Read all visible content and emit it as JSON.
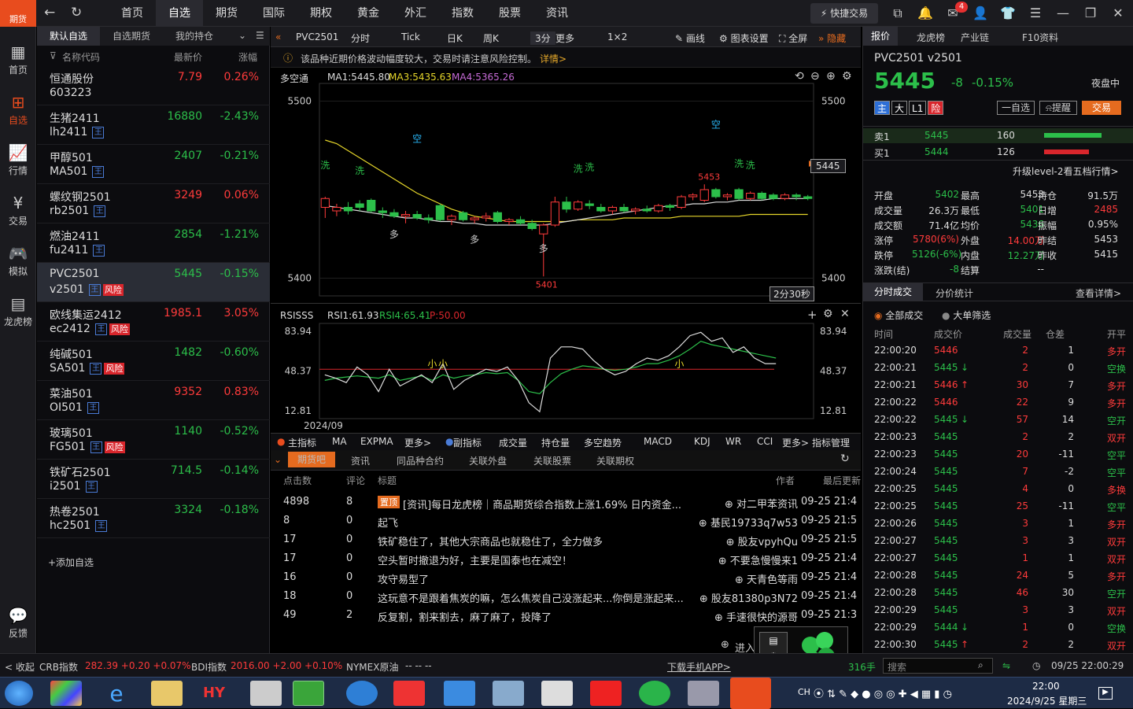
{
  "app": {
    "logo_label": "期货"
  },
  "nav": {
    "items": [
      "首页",
      "自选",
      "期货",
      "国际",
      "期权",
      "黄金",
      "外汇",
      "指数",
      "股票",
      "资讯"
    ],
    "active_index": 1,
    "quick_trade": "快捷交易",
    "mail_badge": "4"
  },
  "leftnav": [
    {
      "label": "首页",
      "icon": "grid-icon"
    },
    {
      "label": "自选",
      "icon": "plus-box-icon"
    },
    {
      "label": "行情",
      "icon": "chart-icon"
    },
    {
      "label": "交易",
      "icon": "yuan-icon"
    },
    {
      "label": "模拟",
      "icon": "gamepad-icon"
    },
    {
      "label": "龙虎榜",
      "icon": "database-icon"
    },
    {
      "label": "反馈",
      "icon": "feedback-icon"
    }
  ],
  "watchlist": {
    "tabs": [
      "默认自选",
      "自选期货",
      "我的持仓"
    ],
    "header": {
      "name": "名称代码",
      "price": "最新价",
      "change": "涨幅"
    },
    "rows": [
      {
        "name": "恒通股份",
        "code": "603223",
        "price": "7.79",
        "change": "0.26%",
        "dir": "up",
        "tag": false,
        "risk": false
      },
      {
        "name": "生猪2411",
        "code": "lh2411",
        "price": "16880",
        "change": "-2.43%",
        "dir": "down",
        "tag": true,
        "risk": false
      },
      {
        "name": "甲醇501",
        "code": "MA501",
        "price": "2407",
        "change": "-0.21%",
        "dir": "down",
        "tag": true,
        "risk": false
      },
      {
        "name": "螺纹钢2501",
        "code": "rb2501",
        "price": "3249",
        "change": "0.06%",
        "dir": "up",
        "tag": true,
        "risk": false
      },
      {
        "name": "燃油2411",
        "code": "fu2411",
        "price": "2854",
        "change": "-1.21%",
        "dir": "down",
        "tag": true,
        "risk": false
      },
      {
        "name": "PVC2501",
        "code": "v2501",
        "price": "5445",
        "change": "-0.15%",
        "dir": "down",
        "tag": true,
        "risk": true
      },
      {
        "name": "欧线集运2412",
        "code": "ec2412",
        "price": "1985.1",
        "change": "3.05%",
        "dir": "up",
        "tag": true,
        "risk": true
      },
      {
        "name": "纯碱501",
        "code": "SA501",
        "price": "1482",
        "change": "-0.60%",
        "dir": "down",
        "tag": true,
        "risk": true
      },
      {
        "name": "菜油501",
        "code": "OI501",
        "price": "9352",
        "change": "0.83%",
        "dir": "up",
        "tag": true,
        "risk": false
      },
      {
        "name": "玻璃501",
        "code": "FG501",
        "price": "1140",
        "change": "-0.52%",
        "dir": "down",
        "tag": true,
        "risk": true
      },
      {
        "name": "铁矿石2501",
        "code": "i2501",
        "price": "714.5",
        "change": "-0.14%",
        "dir": "down",
        "tag": true,
        "risk": false
      },
      {
        "name": "热卷2501",
        "code": "hc2501",
        "price": "3324",
        "change": "-0.18%",
        "dir": "down",
        "tag": true,
        "risk": false
      }
    ],
    "selected_index": 5,
    "tag_char": "王",
    "risk_label": "风险",
    "add": "+添加自选"
  },
  "chartbar": {
    "symbol": "PVC2501",
    "items": [
      "分时",
      "Tick",
      "日K",
      "周K",
      "3分",
      "更多",
      "1×2"
    ],
    "tools": [
      "画线",
      "图表设置",
      "全屏",
      "隐藏"
    ]
  },
  "notice": {
    "text": "该品种近期价格波动幅度较大，交易时请注意风险控制。",
    "link": "详情>"
  },
  "main_chart": {
    "legend": {
      "label": "多空通",
      "ma1": "MA1:5445.80",
      "ma3": "MA3:5435.63",
      "ma4": "MA4:5365.26"
    },
    "ylabels": [
      "5500",
      "5400"
    ],
    "price_tag": "5445",
    "high_label": "5453",
    "low_label": "5401",
    "countdown": "2分30秒",
    "signals": [
      "洗",
      "洗",
      "空",
      "多",
      "多",
      "多",
      "洗",
      "洗",
      "洗",
      "洗",
      "空"
    ]
  },
  "chart_data": {
    "type": "candlestick",
    "ylim": [
      5390,
      5510
    ],
    "candles": [
      {
        "o": 5440,
        "h": 5446,
        "l": 5434,
        "c": 5445
      },
      {
        "o": 5438,
        "h": 5442,
        "l": 5435,
        "c": 5440
      },
      {
        "o": 5440,
        "h": 5443,
        "l": 5436,
        "c": 5438
      },
      {
        "o": 5442,
        "h": 5444,
        "l": 5438,
        "c": 5440
      },
      {
        "o": 5444,
        "h": 5445,
        "l": 5437,
        "c": 5438
      },
      {
        "o": 5438,
        "h": 5440,
        "l": 5434,
        "c": 5437
      },
      {
        "o": 5437,
        "h": 5439,
        "l": 5434,
        "c": 5435
      },
      {
        "o": 5435,
        "h": 5438,
        "l": 5431,
        "c": 5436
      },
      {
        "o": 5436,
        "h": 5438,
        "l": 5433,
        "c": 5434
      },
      {
        "o": 5434,
        "h": 5436,
        "l": 5431,
        "c": 5433
      },
      {
        "o": 5441,
        "h": 5442,
        "l": 5432,
        "c": 5433
      },
      {
        "o": 5433,
        "h": 5436,
        "l": 5430,
        "c": 5435
      },
      {
        "o": 5437,
        "h": 5438,
        "l": 5432,
        "c": 5433
      },
      {
        "o": 5433,
        "h": 5435,
        "l": 5431,
        "c": 5434
      },
      {
        "o": 5434,
        "h": 5437,
        "l": 5432,
        "c": 5435
      },
      {
        "o": 5437,
        "h": 5438,
        "l": 5431,
        "c": 5432
      },
      {
        "o": 5432,
        "h": 5434,
        "l": 5430,
        "c": 5433
      },
      {
        "o": 5433,
        "h": 5435,
        "l": 5430,
        "c": 5431
      },
      {
        "o": 5431,
        "h": 5433,
        "l": 5427,
        "c": 5428
      },
      {
        "o": 5425,
        "h": 5431,
        "l": 5401,
        "c": 5430
      },
      {
        "o": 5430,
        "h": 5446,
        "l": 5429,
        "c": 5443
      },
      {
        "o": 5443,
        "h": 5446,
        "l": 5437,
        "c": 5439
      },
      {
        "o": 5439,
        "h": 5444,
        "l": 5438,
        "c": 5443
      },
      {
        "o": 5442,
        "h": 5444,
        "l": 5439,
        "c": 5441
      },
      {
        "o": 5440,
        "h": 5442,
        "l": 5437,
        "c": 5438
      },
      {
        "o": 5438,
        "h": 5441,
        "l": 5436,
        "c": 5440
      },
      {
        "o": 5440,
        "h": 5442,
        "l": 5437,
        "c": 5438
      },
      {
        "o": 5438,
        "h": 5440,
        "l": 5436,
        "c": 5439
      },
      {
        "o": 5439,
        "h": 5441,
        "l": 5437,
        "c": 5438
      },
      {
        "o": 5438,
        "h": 5442,
        "l": 5437,
        "c": 5441
      },
      {
        "o": 5441,
        "h": 5442,
        "l": 5438,
        "c": 5440
      },
      {
        "o": 5440,
        "h": 5447,
        "l": 5439,
        "c": 5446
      },
      {
        "o": 5446,
        "h": 5448,
        "l": 5444,
        "c": 5447
      },
      {
        "o": 5444,
        "h": 5453,
        "l": 5443,
        "c": 5450
      },
      {
        "o": 5450,
        "h": 5451,
        "l": 5445,
        "c": 5446
      },
      {
        "o": 5446,
        "h": 5448,
        "l": 5444,
        "c": 5447
      },
      {
        "o": 5450,
        "h": 5451,
        "l": 5444,
        "c": 5445
      },
      {
        "o": 5445,
        "h": 5449,
        "l": 5444,
        "c": 5448
      },
      {
        "o": 5448,
        "h": 5449,
        "l": 5444,
        "c": 5445
      },
      {
        "o": 5447,
        "h": 5448,
        "l": 5444,
        "c": 5445
      },
      {
        "o": 5445,
        "h": 5448,
        "l": 5444,
        "c": 5447
      },
      {
        "o": 5447,
        "h": 5448,
        "l": 5444,
        "c": 5446
      },
      {
        "o": 5446,
        "h": 5447,
        "l": 5444,
        "c": 5445
      }
    ],
    "ma1": [
      5441,
      5440,
      5439,
      5438,
      5437,
      5436,
      5435,
      5434,
      5434,
      5433,
      5432,
      5432,
      5431,
      5431,
      5430,
      5430,
      5430,
      5430,
      5430,
      5430,
      5431,
      5432,
      5433,
      5434,
      5435,
      5436,
      5437,
      5438,
      5439,
      5440,
      5441,
      5441,
      5442,
      5442,
      5443,
      5443,
      5444,
      5444,
      5444,
      5445,
      5445,
      5445,
      5445
    ],
    "ma3": [
      5478,
      5476,
      5472,
      5468,
      5464,
      5460,
      5456,
      5452,
      5448,
      5445,
      5442,
      5439,
      5437,
      5435,
      5434,
      5433,
      5432,
      5432,
      5432,
      5432,
      5432,
      5432,
      5433,
      5433,
      5433,
      5433,
      5434,
      5434,
      5434,
      5434,
      5434,
      5435,
      5435,
      5435,
      5435,
      5435,
      5435,
      5436,
      5436,
      5436,
      5436,
      5436,
      5436
    ],
    "ma4": [
      5332,
      5333,
      5334,
      5335,
      5336,
      5337,
      5338,
      5339,
      5340,
      5341,
      5342,
      5342,
      5343,
      5344,
      5345,
      5346,
      5347,
      5348,
      5349,
      5350,
      5350,
      5351,
      5352,
      5353,
      5354,
      5355,
      5356,
      5356,
      5357,
      5358,
      5359,
      5360,
      5361,
      5362,
      5362,
      5363,
      5364,
      5364,
      5365,
      5366,
      5366,
      5367,
      5368
    ]
  },
  "rsi_chart": {
    "legend": {
      "label": "RSISSS",
      "rsi1": "RSI1:61.93",
      "rsi4": "RSI4:65.41",
      "p": "P:50.00"
    },
    "ylabels": [
      "83.94",
      "48.37",
      "12.81"
    ],
    "date": "2024/09",
    "ylim": [
      12.81,
      83.94
    ],
    "rsi1": [
      45,
      42,
      38,
      52,
      45,
      30,
      50,
      35,
      40,
      45,
      38,
      55,
      32,
      40,
      45,
      50,
      48,
      52,
      40,
      20,
      12,
      60,
      70,
      70,
      68,
      58,
      50,
      45,
      48,
      55,
      60,
      58,
      62,
      70,
      80,
      83,
      75,
      78,
      65,
      70,
      60,
      55,
      55
    ],
    "rsi4": [
      40,
      42,
      43,
      44,
      43,
      42,
      45,
      40,
      42,
      44,
      40,
      45,
      42,
      44,
      45,
      47,
      46,
      47,
      40,
      30,
      28,
      38,
      46,
      50,
      53,
      52,
      50,
      49,
      50,
      52,
      55,
      55,
      58,
      62,
      68,
      75,
      72,
      70,
      68,
      66,
      64,
      62,
      60
    ],
    "p": 50,
    "marks": [
      "小",
      "小",
      "小"
    ]
  },
  "indbar": {
    "main": "主指标",
    "items1": [
      "MA",
      "EXPMA",
      "更多>"
    ],
    "sub": "副指标",
    "items2": [
      "成交量",
      "持仓量",
      "多空趋势",
      "MACD",
      "KDJ",
      "WR",
      "CCI",
      "更多>"
    ],
    "manage": "指标管理"
  },
  "news": {
    "tabs": [
      "期货吧",
      "资讯",
      "同品种合约",
      "关联外盘",
      "关联股票",
      "关联期权"
    ],
    "header": {
      "clicks": "点击数",
      "comments": "评论",
      "title": "标题",
      "author": "作者",
      "updated": "最后更新"
    },
    "pinned": "置顶",
    "rows": [
      {
        "clicks": "4898",
        "comments": "8",
        "title": "[资讯]每日龙虎榜｜商品期货综合指数上涨1.69% 日内资金...",
        "author": "对二甲苯资讯",
        "time": "09-25 21:4",
        "pinned": true
      },
      {
        "clicks": "8",
        "comments": "0",
        "title": "起飞",
        "author": "基民19733q7w53",
        "time": "09-25 21:5",
        "pinned": false
      },
      {
        "clicks": "17",
        "comments": "0",
        "title": "铁矿稳住了，其他大宗商品也就稳住了，全力做多",
        "author": "股友vpyhQu",
        "time": "09-25 21:5",
        "pinned": false
      },
      {
        "clicks": "17",
        "comments": "0",
        "title": "空头暂时撤退为好，主要是国泰也在减空！",
        "author": "不要急慢慢来1",
        "time": "09-25 21:4",
        "pinned": false
      },
      {
        "clicks": "16",
        "comments": "0",
        "title": "攻守易型了",
        "author": "天青色等雨",
        "time": "09-25 21:4",
        "pinned": false
      },
      {
        "clicks": "18",
        "comments": "0",
        "title": "这玩意不是跟着焦炭的嘛，怎么焦炭自己没涨起来...你倒是涨起来...",
        "author": "股友81380p3N72",
        "time": "09-25 21:4",
        "pinned": false
      },
      {
        "clicks": "49",
        "comments": "2",
        "title": "反复割，割来割去，麻了麻了，投降了",
        "author": "手速很快的源哥",
        "time": "09-25 21:3",
        "pinned": false
      }
    ],
    "enter": "进入"
  },
  "quote": {
    "tabs": [
      "报价",
      "龙虎榜",
      "产业链",
      "F10资料"
    ],
    "symbol": "PVC2501  v2501",
    "price": "5445",
    "chg": "-8",
    "pct": "-0.15%",
    "session": "夜盘中",
    "badges": [
      "主",
      "大",
      "L1",
      "险"
    ],
    "btn_watch": "一自选",
    "btn_alert": "提醒",
    "btn_trade": "交易",
    "ask": {
      "label": "卖1",
      "price": "5445",
      "vol": "160"
    },
    "bid": {
      "label": "买1",
      "price": "5444",
      "vol": "126"
    },
    "ask_ratio": 0.56,
    "bid_ratio": 0.44,
    "upgrade": "升级level-2看五档行情>",
    "stats": [
      [
        {
          "k": "开盘",
          "v": "5402",
          "c": "green"
        },
        {
          "k": "最高",
          "v": "5453",
          "c": "white"
        },
        {
          "k": "持仓",
          "v": "91.5万",
          "c": "white"
        }
      ],
      [
        {
          "k": "成交量",
          "v": "26.3万",
          "c": "white"
        },
        {
          "k": "最低",
          "v": "5401",
          "c": "green"
        },
        {
          "k": "日增",
          "v": "2485",
          "c": "red"
        }
      ],
      [
        {
          "k": "成交额",
          "v": "71.4亿",
          "c": "white"
        },
        {
          "k": "均价",
          "v": "5436",
          "c": "green"
        },
        {
          "k": "振幅",
          "v": "0.95%",
          "c": "white"
        }
      ],
      [
        {
          "k": "涨停",
          "v": "5780(6%)",
          "c": "red"
        },
        {
          "k": "外盘",
          "v": "14.00万",
          "c": "red"
        },
        {
          "k": "昨结",
          "v": "5453",
          "c": "white"
        }
      ],
      [
        {
          "k": "跌停",
          "v": "5126(-6%)",
          "c": "green"
        },
        {
          "k": "内盘",
          "v": "12.27万",
          "c": "green"
        },
        {
          "k": "昨收",
          "v": "5415",
          "c": "white"
        }
      ],
      [
        {
          "k": "涨跌(结)",
          "v": "-8",
          "c": "green"
        },
        {
          "k": "结算",
          "v": "--",
          "c": "white"
        },
        {
          "k": "",
          "v": "",
          "c": "white"
        }
      ]
    ],
    "trade_tabs": [
      "分时成交",
      "分价统计"
    ],
    "details": "查看详情>",
    "filters": [
      "全部成交",
      "大单筛选"
    ],
    "trade_header": [
      "时间",
      "成交价",
      "成交量",
      "仓差",
      "开平"
    ],
    "trades": [
      [
        "22:00:20",
        "5446",
        "",
        "2",
        "1",
        "多开"
      ],
      [
        "22:00:21",
        "5445",
        "↓",
        "2",
        "0",
        "空换"
      ],
      [
        "22:00:21",
        "5446",
        "↑",
        "30",
        "7",
        "多开"
      ],
      [
        "22:00:22",
        "5446",
        "",
        "22",
        "9",
        "多开"
      ],
      [
        "22:00:22",
        "5445",
        "↓",
        "57",
        "14",
        "空开"
      ],
      [
        "22:00:23",
        "5445",
        "",
        "2",
        "2",
        "双开"
      ],
      [
        "22:00:23",
        "5445",
        "",
        "20",
        "-11",
        "空平"
      ],
      [
        "22:00:24",
        "5445",
        "",
        "7",
        "-2",
        "空平"
      ],
      [
        "22:00:25",
        "5445",
        "",
        "4",
        "0",
        "多换"
      ],
      [
        "22:00:25",
        "5445",
        "",
        "25",
        "-11",
        "空平"
      ],
      [
        "22:00:26",
        "5445",
        "",
        "3",
        "1",
        "多开"
      ],
      [
        "22:00:27",
        "5445",
        "",
        "3",
        "3",
        "双开"
      ],
      [
        "22:00:27",
        "5445",
        "",
        "1",
        "1",
        "双开"
      ],
      [
        "22:00:28",
        "5445",
        "",
        "24",
        "5",
        "多开"
      ],
      [
        "22:00:28",
        "5445",
        "",
        "46",
        "30",
        "空开"
      ],
      [
        "22:00:29",
        "5445",
        "",
        "3",
        "3",
        "双开"
      ],
      [
        "22:00:29",
        "5444",
        "↓",
        "1",
        "0",
        "空换"
      ],
      [
        "22:00:30",
        "5445",
        "↑",
        "2",
        "2",
        "双开"
      ]
    ]
  },
  "status": {
    "collapse": "< 收起",
    "idx": [
      {
        "n": "CRB指数",
        "v": "282.39 +0.20 +0.07%"
      },
      {
        "n": "BDI指数",
        "v": "2016.00 +2.00 +0.10%"
      },
      {
        "n": "NYMEX原油",
        "v": "--  --  --"
      }
    ],
    "download": "下载手机APP>",
    "vol": "316手",
    "search": "搜索",
    "datetime": "09/25 22:00:29"
  },
  "taskbar": {
    "time": "22:00",
    "date": "2024/9/25 星期三",
    "ime": "CH"
  }
}
